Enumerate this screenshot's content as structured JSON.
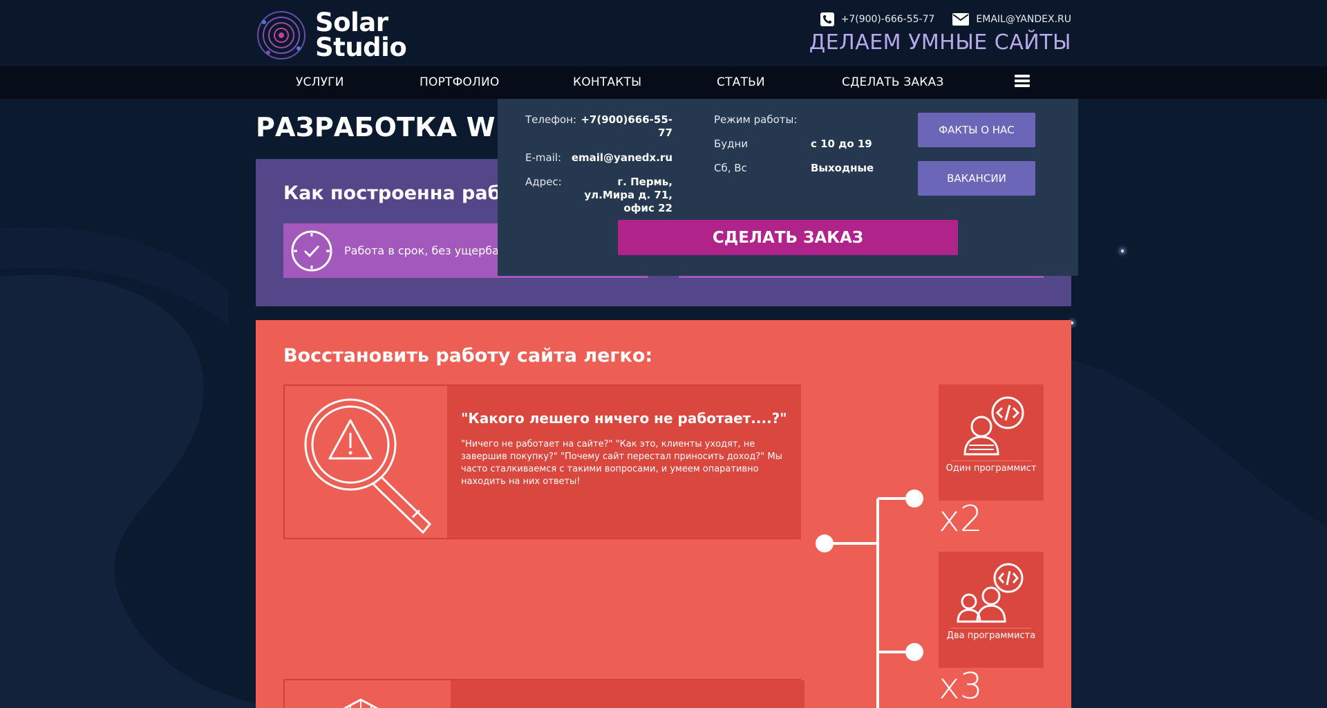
{
  "header": {
    "logo_line1": "Solar",
    "logo_line2": "Studio",
    "phone": "+7(900)-666-55-77",
    "email": "EMAIL@YANDEX.RU",
    "slogan": "ДЕЛАЕМ УМНЫЕ САЙТЫ"
  },
  "nav": {
    "items": [
      "УСЛУГИ",
      "ПОРТФОЛИО",
      "КОНТАКТЫ",
      "СТАТЬИ",
      "СДЕЛАТЬ ЗАКАЗ"
    ]
  },
  "page_title": "РАЗРАБОТКА WEB-",
  "purple_section": {
    "title": "Как построенна работа",
    "feature_text": "Работа в срок, без ущерба д"
  },
  "dropdown": {
    "phone_label": "Телефон:",
    "phone_value": "+7(900)666-55-77",
    "email_label": "E-mail:",
    "email_value": "email@yanedx.ru",
    "address_label": "Адрес:",
    "address_value": "г. Пермь, ул.Мира д. 71, офис 22",
    "hours_label": "Режим работы:",
    "weekdays_label": "Будни",
    "weekdays_value": "с 10 до 19",
    "weekend_label": "Сб, Вс",
    "weekend_value": "Выходные",
    "facts_button": "ФАКТЫ О НАС",
    "vacancies_button": "ВАКАНСИИ",
    "order_button": "СДЕЛАТЬ ЗАКАЗ"
  },
  "red_section": {
    "title": "Восстановить работу сайта легко:",
    "card_title": "\"Какого лешего ничего не работает....?\"",
    "card_text": "\"Ничего не работает на сайте?\" \"Как это, клиенты уходят, не завершив покупку?\" \"Почему сайт перестал приносить доход?\" Мы часто сталкиваемся с такими вопросами, и умеем опаративно находить на них ответы!",
    "programmer_one": "Один программист",
    "programmer_two": "Два программиста",
    "mult_2": "x2",
    "mult_3": "x3"
  },
  "colors": {
    "background": "#0c1a30",
    "purple_section": "#534689",
    "feature_bg": "#a259bb",
    "dropdown_bg": "#263850",
    "button_bg": "#6b66b8",
    "order_bg": "#b0238a",
    "red_section": "#ed5e55",
    "slogan": "#b7a9ea"
  },
  "icons": [
    "logo-icon",
    "phone-icon",
    "mail-icon",
    "menu-icon",
    "clock-check-icon",
    "magnifier-warning-icon",
    "programmer-icon",
    "two-programmers-icon"
  ]
}
